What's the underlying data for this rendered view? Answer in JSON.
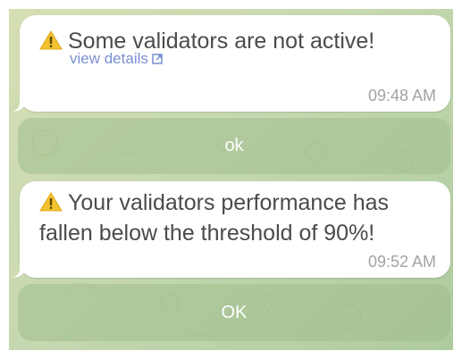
{
  "messages": [
    {
      "icon": "warning-icon",
      "text": "Some validators are not active!",
      "link_text": "view details",
      "time": "09:48 AM",
      "button_label": "ok"
    },
    {
      "icon": "warning-icon",
      "text": "Your validators performance has fallen below the threshold of 90%!",
      "time": "09:52 AM",
      "button_label": "OK"
    }
  ],
  "colors": {
    "bubble": "#ffffff",
    "text": "#4b4b4b",
    "link": "#7b8fd1",
    "time": "#a3a3a3",
    "button_bg": "#a0be8c",
    "warning": "#f2c230"
  }
}
